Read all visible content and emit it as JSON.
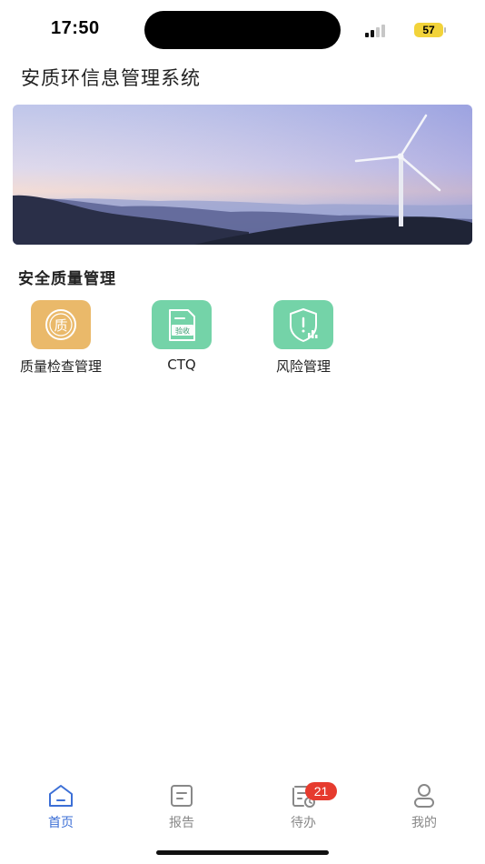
{
  "status_bar": {
    "time": "17:50",
    "battery": "57"
  },
  "app": {
    "title": "安质环信息管理系统"
  },
  "section": {
    "title": "安全质量管理"
  },
  "modules": [
    {
      "label": "质量检查管理",
      "icon": "quality-seal-icon",
      "color": "#eab96a",
      "glyph": "质"
    },
    {
      "label": "CTQ",
      "icon": "acceptance-doc-icon",
      "color": "#74d3a8",
      "glyph": "验收"
    },
    {
      "label": "风险管理",
      "icon": "risk-shield-icon",
      "color": "#74d3a8"
    }
  ],
  "tabs": [
    {
      "label": "首页",
      "icon": "home-icon",
      "active": true
    },
    {
      "label": "报告",
      "icon": "report-icon",
      "active": false
    },
    {
      "label": "待办",
      "icon": "todo-icon",
      "active": false,
      "badge": "21"
    },
    {
      "label": "我的",
      "icon": "profile-icon",
      "active": false
    }
  ],
  "colors": {
    "accent": "#3c6fd6",
    "badge": "#e63b2e",
    "inactive": "#888888"
  }
}
